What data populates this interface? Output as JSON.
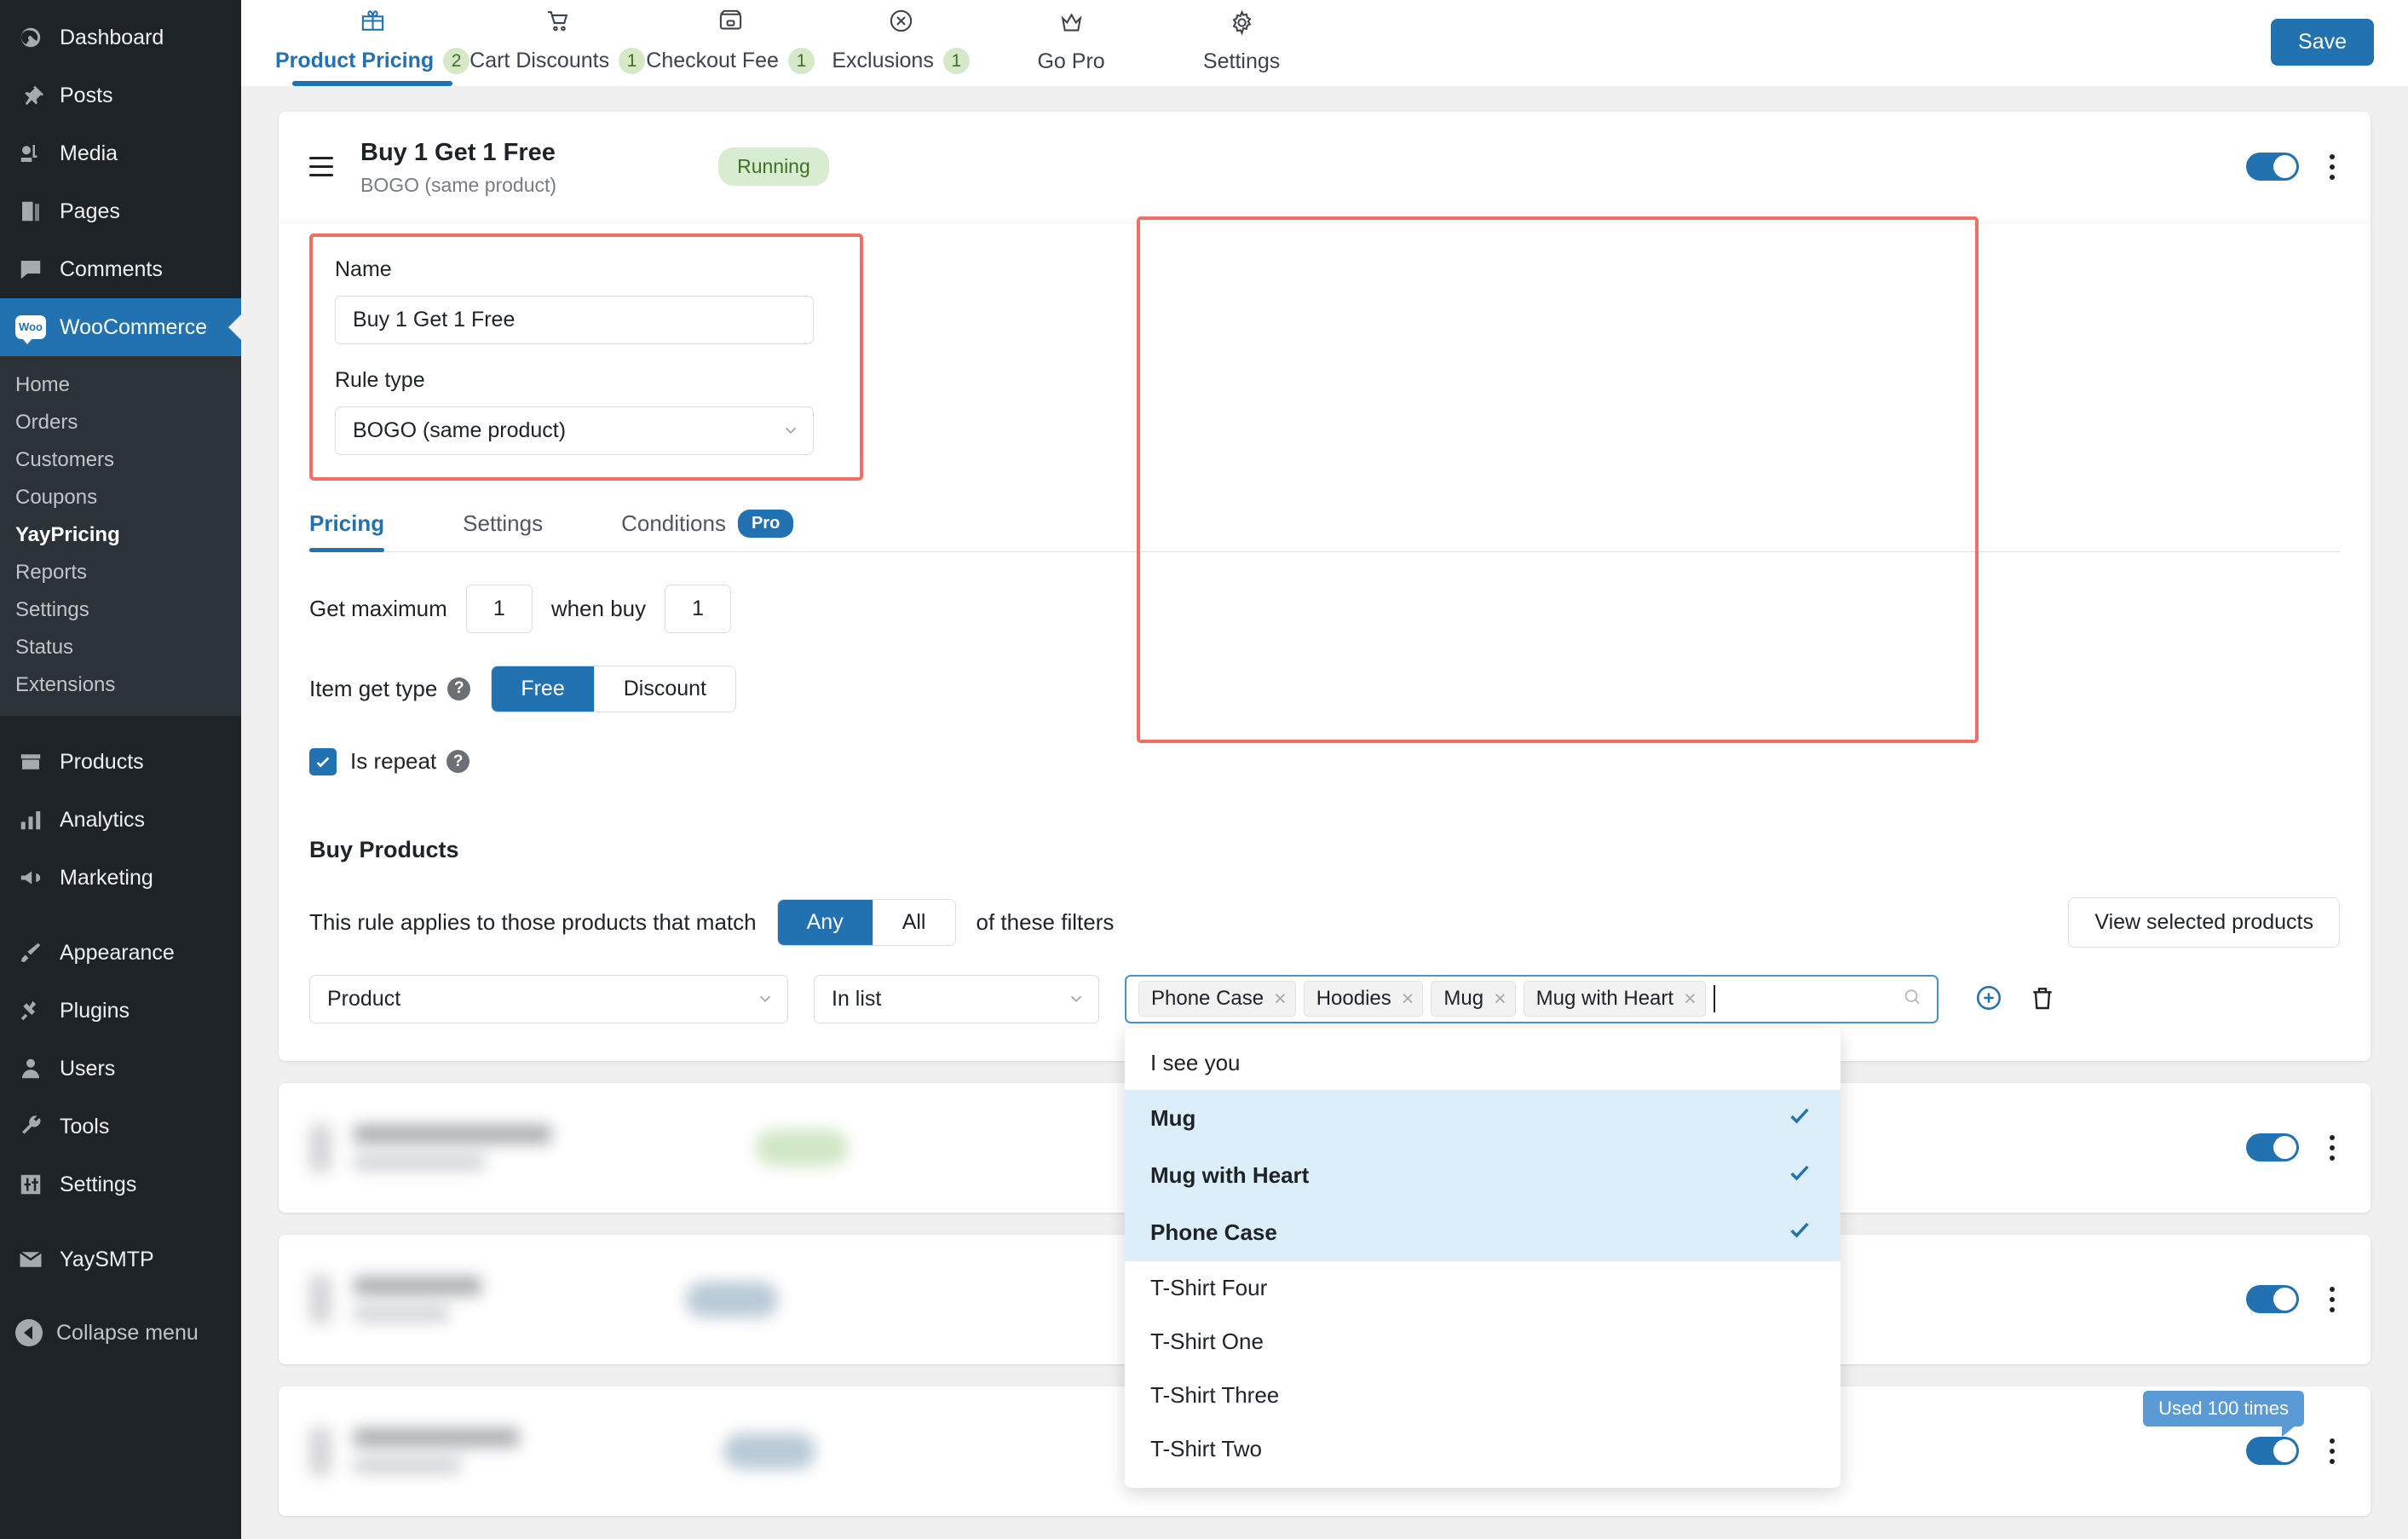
{
  "sidebar": {
    "top_items": [
      {
        "label": "Dashboard",
        "icon": "dashboard-icon"
      },
      {
        "label": "Posts",
        "icon": "pin-icon"
      },
      {
        "label": "Media",
        "icon": "media-icon"
      },
      {
        "label": "Pages",
        "icon": "pages-icon"
      },
      {
        "label": "Comments",
        "icon": "comments-icon"
      }
    ],
    "active_item": {
      "label": "WooCommerce",
      "icon": "woo-logo-icon"
    },
    "woo_logo_text": "Woo",
    "sub_items": [
      {
        "label": "Home",
        "current": false
      },
      {
        "label": "Orders",
        "current": false
      },
      {
        "label": "Customers",
        "current": false
      },
      {
        "label": "Coupons",
        "current": false
      },
      {
        "label": "YayPricing",
        "current": true
      },
      {
        "label": "Reports",
        "current": false
      },
      {
        "label": "Settings",
        "current": false
      },
      {
        "label": "Status",
        "current": false
      },
      {
        "label": "Extensions",
        "current": false
      }
    ],
    "group2": [
      {
        "label": "Products",
        "icon": "products-icon"
      },
      {
        "label": "Analytics",
        "icon": "analytics-icon"
      },
      {
        "label": "Marketing",
        "icon": "marketing-icon"
      }
    ],
    "group3": [
      {
        "label": "Appearance",
        "icon": "brush-icon"
      },
      {
        "label": "Plugins",
        "icon": "plug-icon"
      },
      {
        "label": "Users",
        "icon": "user-icon"
      },
      {
        "label": "Tools",
        "icon": "wrench-icon"
      },
      {
        "label": "Settings",
        "icon": "settings-icon"
      }
    ],
    "group4": [
      {
        "label": "YaySMTP",
        "icon": "envelope-icon"
      }
    ],
    "collapse_label": "Collapse menu"
  },
  "topnav": {
    "tabs": [
      {
        "label": "Product Pricing",
        "badge": "2",
        "icon": "gift-icon",
        "active": true
      },
      {
        "label": "Cart Discounts",
        "badge": "1",
        "icon": "cart-icon",
        "active": false
      },
      {
        "label": "Checkout Fee",
        "badge": "1",
        "icon": "checkout-icon",
        "active": false
      },
      {
        "label": "Exclusions",
        "badge": "1",
        "icon": "x-circle-icon",
        "active": false
      },
      {
        "label": "Go Pro",
        "badge": "",
        "icon": "crown-icon",
        "active": false
      },
      {
        "label": "Settings",
        "badge": "",
        "icon": "gear-icon",
        "active": false
      }
    ],
    "save_label": "Save"
  },
  "rule": {
    "title": "Buy 1 Get 1 Free",
    "subtitle": "BOGO (same product)",
    "status": "Running",
    "name_label": "Name",
    "name_value": "Buy 1 Get 1 Free",
    "rule_type_label": "Rule type",
    "rule_type_value": "BOGO (same product)",
    "tabs": [
      {
        "label": "Pricing",
        "active": true,
        "badge": ""
      },
      {
        "label": "Settings",
        "active": false,
        "badge": ""
      },
      {
        "label": "Conditions",
        "active": false,
        "badge": "Pro"
      }
    ],
    "get_maximum_label": "Get maximum",
    "get_maximum_value": "1",
    "when_buy_label": "when buy",
    "when_buy_value": "1",
    "item_get_type_label": "Item get type",
    "item_get_type_options": [
      {
        "label": "Free",
        "selected": true
      },
      {
        "label": "Discount",
        "selected": false
      }
    ],
    "is_repeat_label": "Is repeat",
    "is_repeat_checked": true,
    "buy_products_title": "Buy Products",
    "match_prefix": "This rule applies to those products that match",
    "match_options": [
      {
        "label": "Any",
        "selected": true
      },
      {
        "label": "All",
        "selected": false
      }
    ],
    "match_suffix": "of these filters",
    "view_selected_label": "View selected products",
    "filter_field": "Product",
    "filter_operator": "In list",
    "selected_tags": [
      "Phone Case",
      "Hoodies",
      "Mug",
      "Mug with Heart"
    ],
    "dropdown_options": [
      {
        "label": "I see you",
        "selected": false
      },
      {
        "label": "Mug",
        "selected": true
      },
      {
        "label": "Mug with Heart",
        "selected": true
      },
      {
        "label": "Phone Case",
        "selected": true
      },
      {
        "label": "T-Shirt Four",
        "selected": false
      },
      {
        "label": "T-Shirt One",
        "selected": false
      },
      {
        "label": "T-Shirt Three",
        "selected": false
      },
      {
        "label": "T-Shirt Two",
        "selected": false
      }
    ]
  },
  "other_rules": [
    {
      "pill_color": "#cfe6c4"
    },
    {
      "pill_color": "#b9c9d6"
    },
    {
      "pill_color": "#b9c9d6",
      "tooltip": "Used 100 times"
    }
  ],
  "colors": {
    "accent": "#2271b1",
    "sidebar_bg": "#1d2327",
    "highlight_border": "#f26d62",
    "status_green_bg": "#d7ecd1",
    "status_green_text": "#3f7023",
    "dropdown_selected_bg": "#ddeefb",
    "tooltip_bg": "#5b9bd5"
  }
}
